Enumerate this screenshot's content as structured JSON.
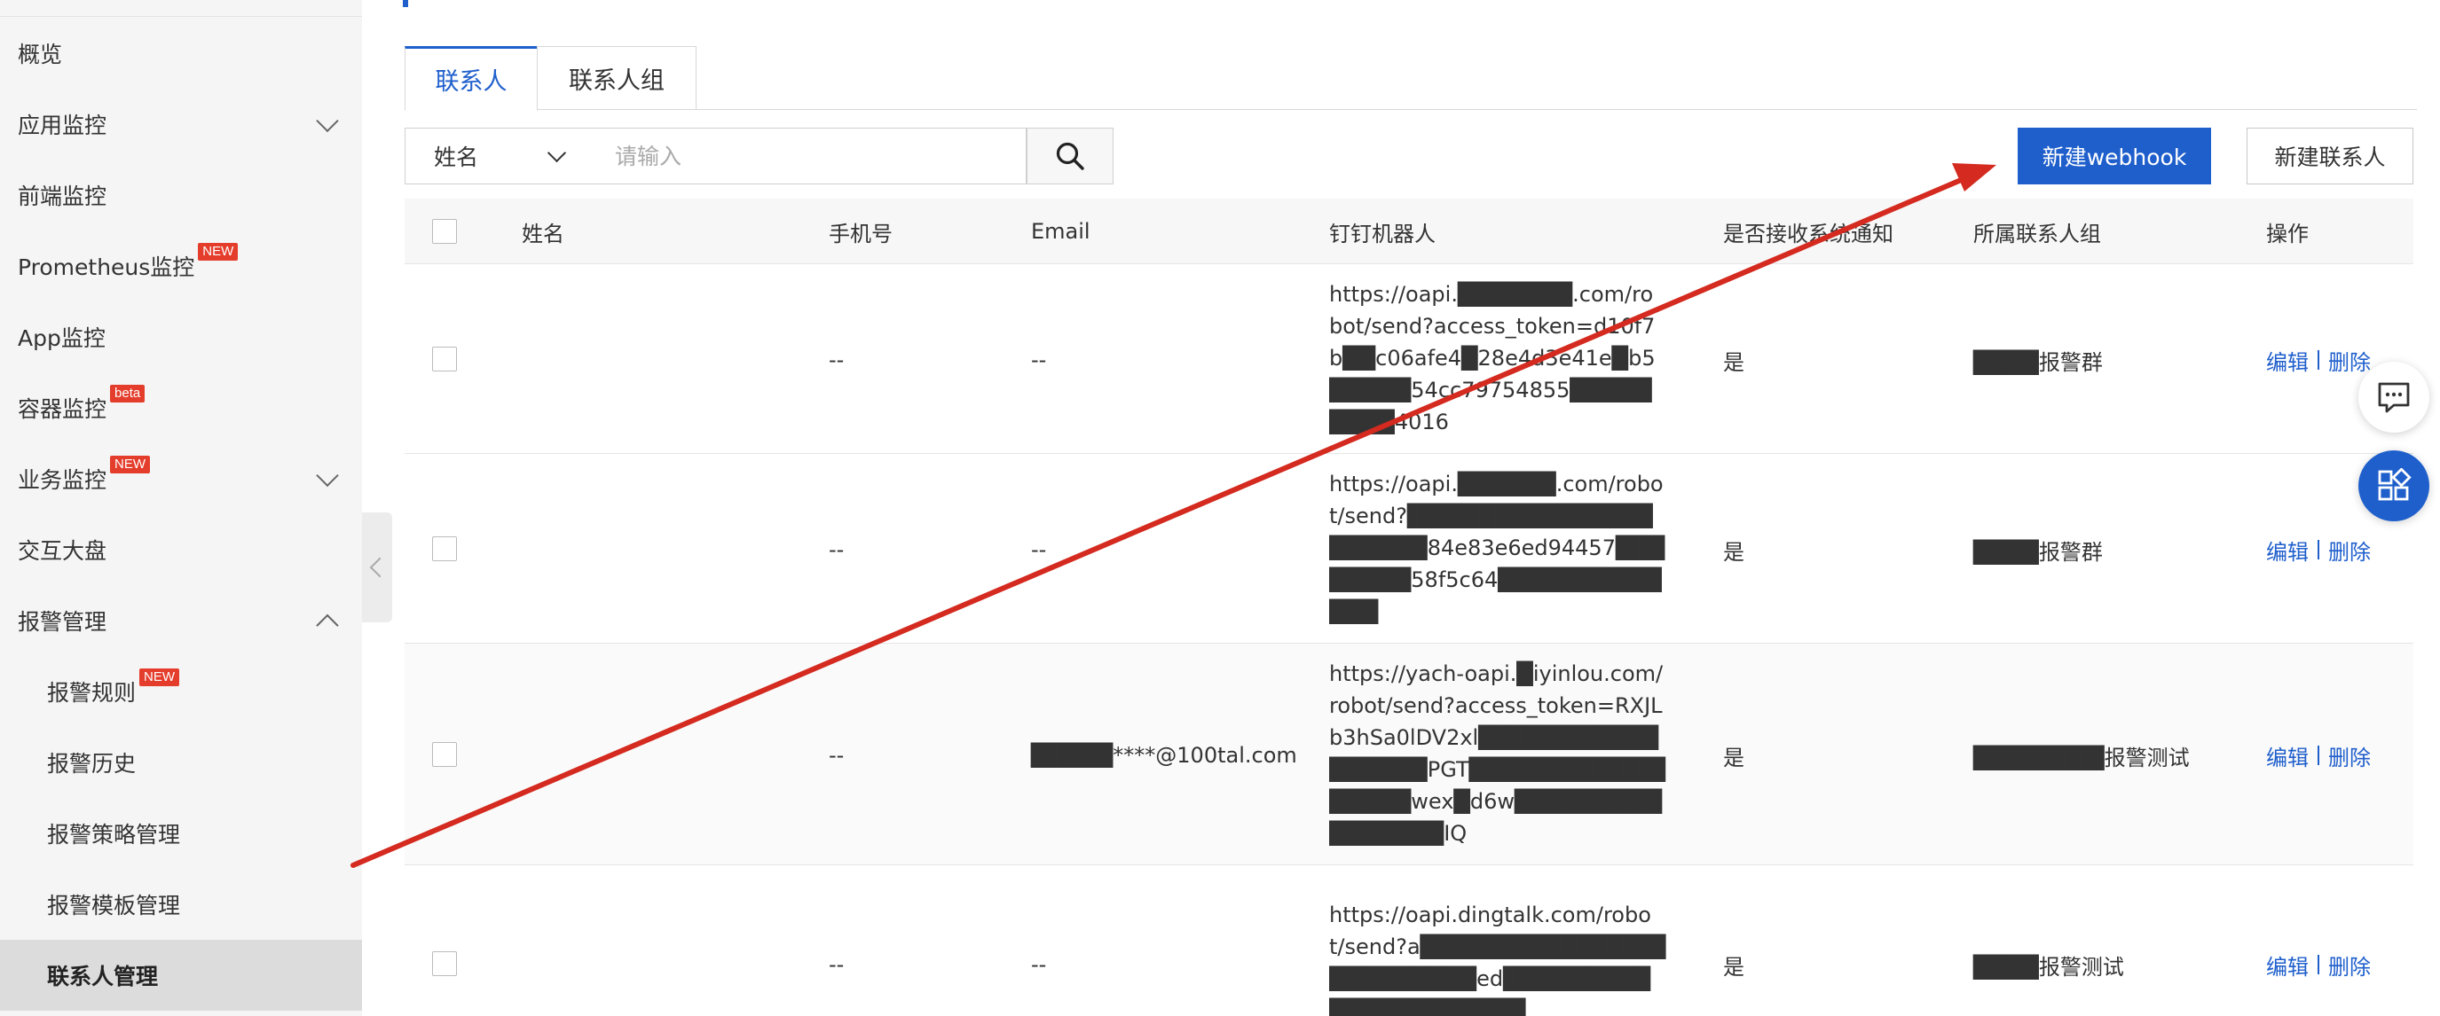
{
  "sidebar": {
    "items": [
      {
        "label": "概览"
      },
      {
        "label": "应用监控"
      },
      {
        "label": "前端监控"
      },
      {
        "label": "Prometheus监控",
        "badge": "NEW"
      },
      {
        "label": "App监控"
      },
      {
        "label": "容器监控",
        "badge": "beta"
      },
      {
        "label": "业务监控",
        "badge": "NEW"
      },
      {
        "label": "交互大盘"
      },
      {
        "label": "报警管理"
      },
      {
        "label": "报警规则",
        "badge": "NEW"
      },
      {
        "label": "报警历史"
      },
      {
        "label": "报警策略管理"
      },
      {
        "label": "报警模板管理"
      },
      {
        "label": "联系人管理"
      }
    ]
  },
  "tabs": [
    {
      "label": "联系人"
    },
    {
      "label": "联系人组"
    }
  ],
  "search": {
    "field_select": "姓名",
    "placeholder": "请输入"
  },
  "actions": {
    "new_webhook": "新建webhook",
    "new_contact": "新建联系人"
  },
  "table": {
    "headers": [
      "姓名",
      "手机号",
      "Email",
      "钉钉机器人",
      "是否接收系统通知",
      "所属联系人组",
      "操作"
    ],
    "rows": [
      {
        "name": "",
        "phone": "--",
        "email": "--",
        "robot": "https://oapi.███████.com/robot/send?access_token=d10f7b██c06afe4█28e4d3e41e█b5█████54cc79754855█████████4016",
        "notify": "是",
        "group": "████报警群",
        "edit": "编辑",
        "delete": "删除"
      },
      {
        "name": "",
        "phone": "--",
        "email": "--",
        "robot": "https://oapi.██████.com/robot/send?█████████████████████84e83e6ed94457████████58f5c64█████████████",
        "notify": "是",
        "group": "████报警群",
        "edit": "编辑",
        "delete": "删除"
      },
      {
        "name": "",
        "phone": "--",
        "email": "█████****@100tal.com",
        "robot": "https://yach-oapi.█iyinlou.com/robot/send?access_token=RXJLb3hSa0lDV2xl█████████████████PGT█████████████████wex█d6w████████████████IQ",
        "notify": "是",
        "group": "████████报警测试",
        "edit": "编辑",
        "delete": "删除"
      },
      {
        "name": "",
        "phone": "--",
        "email": "--",
        "robot": "https://oapi.dingtalk.com/robot/send?a████████████████████████ed█████████████████████",
        "notify": "是",
        "group": "████报警测试",
        "edit": "编辑",
        "delete": "删除"
      }
    ]
  },
  "colors": {
    "accent": "#1f5fcc",
    "annotation_arrow": "#d42a1f",
    "badge": "#e43d2b",
    "sidebar_bg": "#f5f5f5",
    "sidebar_active": "#dcdcdc"
  },
  "icons": {
    "search": "magnifier-icon",
    "chat": "chat-bubble-icon",
    "apps": "app-grid-icon",
    "collapse": "chevron-left-icon"
  }
}
